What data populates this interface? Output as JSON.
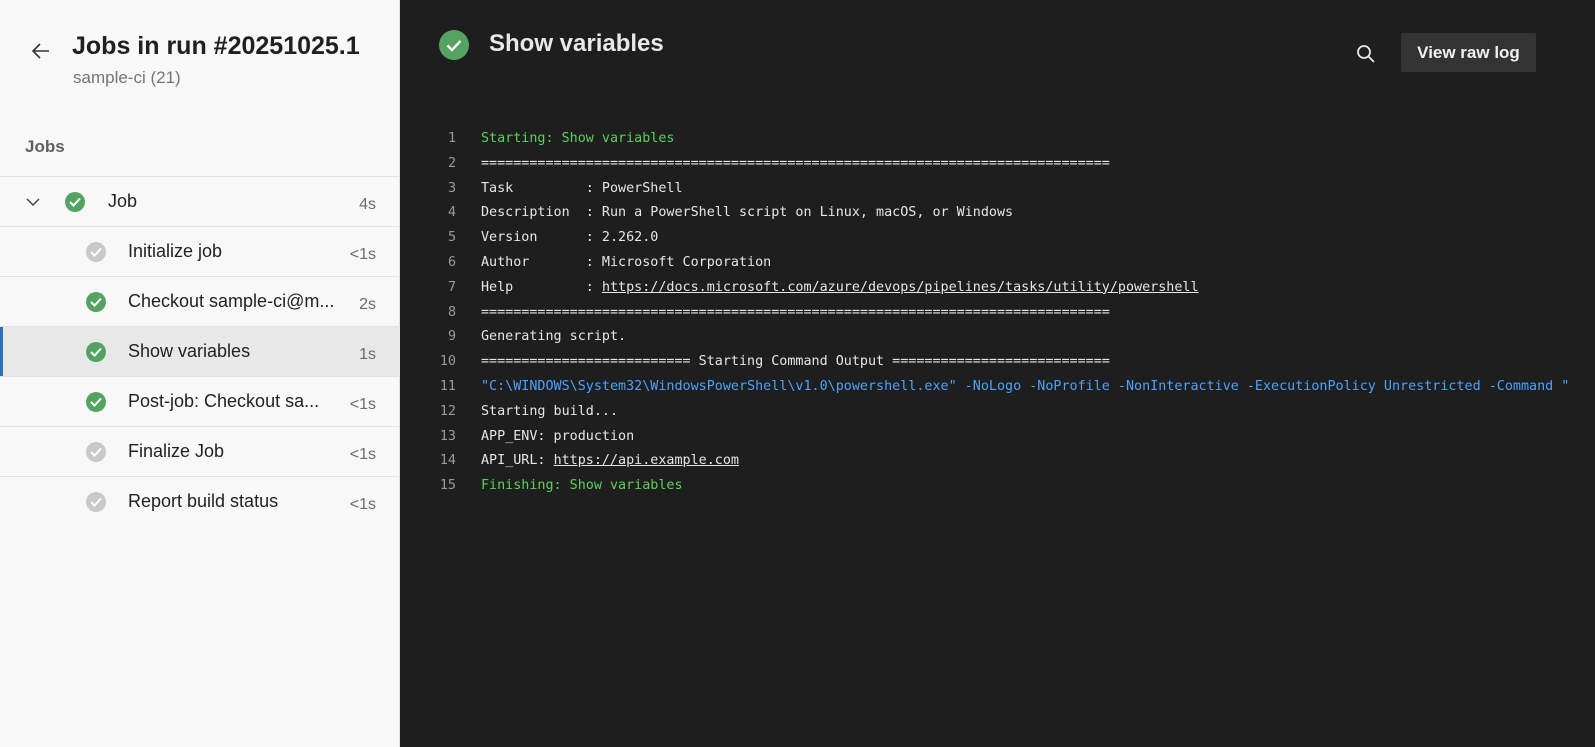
{
  "sidebar": {
    "title": "Jobs in run #20251025.1",
    "subtitle": "sample-ci (21)",
    "jobs_heading": "Jobs",
    "parent_job": {
      "label": "Job",
      "time": "4s",
      "status": "success"
    },
    "steps": [
      {
        "label": "Initialize job",
        "time": "<1s",
        "status": "skipped"
      },
      {
        "label": "Checkout sample-ci@m...",
        "time": "2s",
        "status": "success"
      },
      {
        "label": "Show variables",
        "time": "1s",
        "status": "success",
        "selected": true
      },
      {
        "label": "Post-job: Checkout sa...",
        "time": "<1s",
        "status": "success"
      },
      {
        "label": "Finalize Job",
        "time": "<1s",
        "status": "skipped"
      },
      {
        "label": "Report build status",
        "time": "<1s",
        "status": "skipped"
      }
    ]
  },
  "main": {
    "title": "Show variables",
    "view_raw_log_label": "View raw log",
    "log": [
      {
        "n": "1",
        "text": "Starting: Show variables",
        "style": "green"
      },
      {
        "n": "2",
        "text": "==============================================================================",
        "style": "normal"
      },
      {
        "n": "3",
        "text": "Task         : PowerShell",
        "style": "normal"
      },
      {
        "n": "4",
        "text": "Description  : Run a PowerShell script on Linux, macOS, or Windows",
        "style": "normal"
      },
      {
        "n": "5",
        "text": "Version      : 2.262.0",
        "style": "normal"
      },
      {
        "n": "6",
        "text": "Author       : Microsoft Corporation",
        "style": "normal"
      },
      {
        "n": "7",
        "text": "Help         : ",
        "link": "https://docs.microsoft.com/azure/devops/pipelines/tasks/utility/powershell",
        "style": "normal"
      },
      {
        "n": "8",
        "text": "==============================================================================",
        "style": "normal"
      },
      {
        "n": "9",
        "text": "Generating script.",
        "style": "normal"
      },
      {
        "n": "10",
        "text": "========================== Starting Command Output ===========================",
        "style": "normal"
      },
      {
        "n": "11",
        "text": "\"C:\\WINDOWS\\System32\\WindowsPowerShell\\v1.0\\powershell.exe\" -NoLogo -NoProfile -NonInteractive -ExecutionPolicy Unrestricted -Command \"",
        "style": "blue"
      },
      {
        "n": "12",
        "text": "Starting build...",
        "style": "normal"
      },
      {
        "n": "13",
        "text": "APP_ENV: production",
        "style": "normal"
      },
      {
        "n": "14",
        "text": "API_URL: ",
        "link": "https://api.example.com",
        "style": "normal"
      },
      {
        "n": "15",
        "text": "Finishing: Show variables",
        "style": "green"
      }
    ]
  },
  "colors": {
    "success": "#55a362",
    "skipped": "#c9c9c9",
    "accent": "#2f6fb3",
    "log_green": "#5bd15b",
    "log_blue": "#4aa3ff"
  },
  "icons": {
    "back": "arrow-left-icon",
    "chevron": "chevron-down-icon",
    "success": "check-circle-icon",
    "skipped": "check-circle-gray-icon",
    "search": "search-icon"
  }
}
